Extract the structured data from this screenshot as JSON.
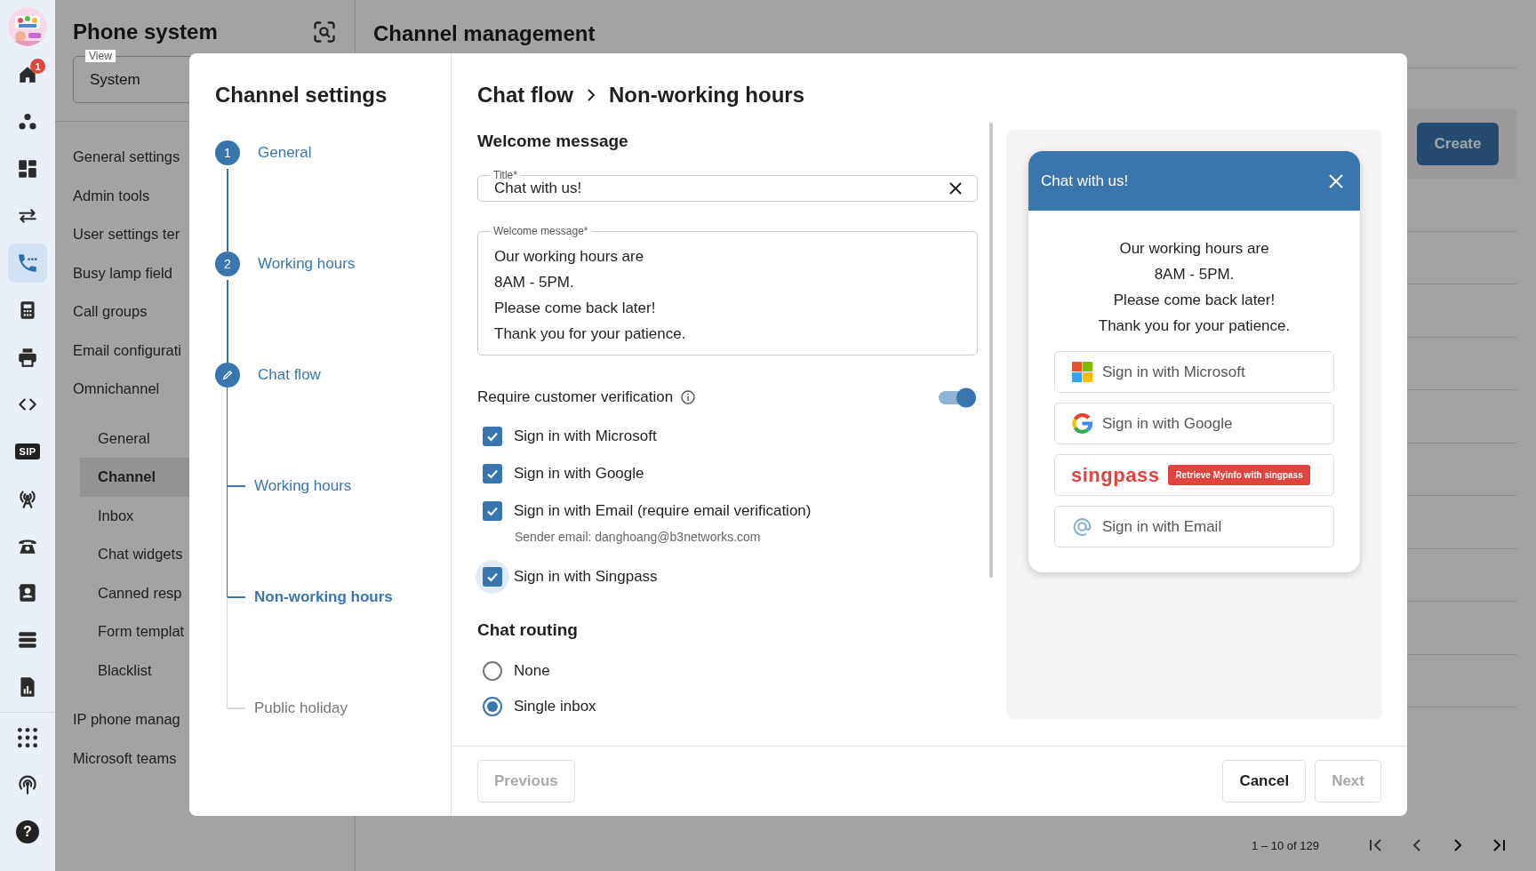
{
  "rail": {
    "items": [
      {
        "selected": false,
        "badge": "1"
      },
      {
        "selected": false
      },
      {
        "selected": false
      },
      {
        "selected": false
      },
      {
        "selected": true
      },
      {
        "selected": false
      },
      {
        "selected": false
      },
      {
        "selected": false
      },
      {
        "selected": false,
        "label": "SIP"
      },
      {
        "selected": false
      },
      {
        "selected": false
      },
      {
        "selected": false
      },
      {
        "selected": false
      },
      {
        "selected": false
      }
    ],
    "bottom_items": [
      {
        "selected": false
      },
      {
        "selected": false
      },
      {
        "selected": false,
        "label": "?"
      }
    ]
  },
  "panel": {
    "title": "Phone system",
    "view": {
      "label": "View",
      "value": "System"
    },
    "nav": [
      {
        "label": "General settings",
        "selected": false
      },
      {
        "label": "Admin tools",
        "selected": false
      },
      {
        "label": "User settings ter",
        "selected": false
      },
      {
        "label": "Busy lamp field",
        "selected": false
      },
      {
        "label": "Call groups",
        "selected": false
      },
      {
        "label": "Email configurati",
        "selected": false
      },
      {
        "label": "Omnichannel",
        "selected": false,
        "children": [
          {
            "label": "General",
            "selected": false
          },
          {
            "label": "Channel",
            "selected": true
          },
          {
            "label": "Inbox",
            "selected": false
          },
          {
            "label": "Chat widgets",
            "selected": false
          },
          {
            "label": "Canned resp",
            "selected": false
          },
          {
            "label": "Form templat",
            "selected": false
          },
          {
            "label": "Blacklist",
            "selected": false
          }
        ]
      },
      {
        "label": "IP phone manag",
        "selected": false
      },
      {
        "label": "Microsoft teams",
        "selected": false
      }
    ]
  },
  "main": {
    "title": "Channel management",
    "create_button": "Create",
    "pagination": "1 – 10 of 129"
  },
  "modal": {
    "title": "Channel settings",
    "steps": [
      {
        "number": "1",
        "label": "General",
        "editing": false
      },
      {
        "number": "2",
        "label": "Working hours",
        "editing": false
      },
      {
        "label": "Chat flow",
        "editing": true,
        "children": [
          {
            "label": "Working hours",
            "pending": false,
            "selected": false
          },
          {
            "label": "Non-working hours",
            "pending": false,
            "selected": true
          },
          {
            "label": "Public holiday",
            "pending": true,
            "selected": false
          }
        ]
      }
    ],
    "breadcrumb": [
      "Chat flow",
      "Non-working hours"
    ],
    "welcome_heading": "Welcome message",
    "title_field": {
      "label": "Title*",
      "value": "Chat with us!"
    },
    "message_field": {
      "label": "Welcome message*",
      "lines": [
        "Our working hours are",
        "8AM - 5PM.",
        "Please come back later!",
        "Thank you for your patience."
      ]
    },
    "verification": {
      "label": "Require customer verification",
      "on": true,
      "options": [
        {
          "label": "Sign in with Microsoft",
          "checked": true,
          "focused": false
        },
        {
          "label": "Sign in with Google",
          "checked": true,
          "focused": false
        },
        {
          "label": "Sign in with Email (require email verification)",
          "checked": true,
          "focused": false,
          "note": "Sender email: danghoang@b3networks.com"
        },
        {
          "label": "Sign in with Singpass",
          "checked": true,
          "focused": true
        }
      ]
    },
    "routing": {
      "heading": "Chat routing",
      "options": [
        {
          "label": "None",
          "selected": false
        },
        {
          "label": "Single inbox",
          "selected": true
        }
      ]
    },
    "preview": {
      "title": "Chat with us!",
      "lines": [
        "Our working hours are",
        "8AM - 5PM.",
        "Please come back later!",
        "Thank you for your patience."
      ],
      "buttons": [
        {
          "kind": "microsoft",
          "label": "Sign in with Microsoft"
        },
        {
          "kind": "google",
          "label": "Sign in with Google"
        },
        {
          "kind": "singpass",
          "label": "singpass",
          "badge": "Retrieve Myinfo with singpass"
        },
        {
          "kind": "email",
          "label": "Sign in with Email"
        }
      ]
    },
    "footer": {
      "previous": {
        "label": "Previous",
        "disabled": true
      },
      "cancel": {
        "label": "Cancel",
        "disabled": false
      },
      "next": {
        "label": "Next",
        "disabled": true
      }
    }
  }
}
